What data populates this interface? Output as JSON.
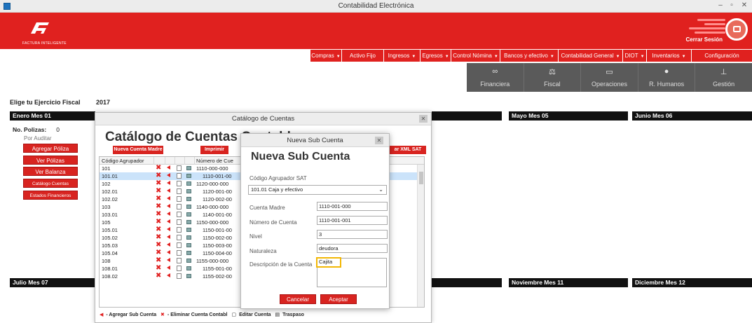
{
  "window": {
    "title": "Contabilidad Electrónica"
  },
  "brand": {
    "logo_text": "FACTURA INTELIGENTE",
    "logout": "Cerrar Sesión",
    "accent": "#e0211f"
  },
  "menu": [
    {
      "label": "Compras"
    },
    {
      "label": "Activo Fijo"
    },
    {
      "label": "Ingresos"
    },
    {
      "label": "Egresos"
    },
    {
      "label": "Control Nómina"
    },
    {
      "label": "Bancos y efectivo"
    },
    {
      "label": "Contabilidad General"
    },
    {
      "label": "DIOT"
    },
    {
      "label": "Inventarios"
    },
    {
      "label": "Configuración"
    }
  ],
  "modules": [
    {
      "label": "Financiera",
      "icon": "coins-icon"
    },
    {
      "label": "Fiscal",
      "icon": "scale-icon"
    },
    {
      "label": "Operaciones",
      "icon": "screen-icon"
    },
    {
      "label": "R. Humanos",
      "icon": "person-icon"
    },
    {
      "label": "Gestión",
      "icon": "org-chart-icon"
    }
  ],
  "fiscal": {
    "label": "Elige tu Ejercicio Fiscal",
    "year": "2017"
  },
  "months": {
    "m01": "Enero Mes 01",
    "m05": "Mayo Mes 05",
    "m06": "Junio Mes 06",
    "m07": "Julio Mes 07",
    "m11": "Noviembre Mes 11",
    "m12": "Diciembre Mes 12"
  },
  "left": {
    "polizas_label": "No. Polizas:",
    "polizas_count": "0",
    "por_auditar": "Por Auditar",
    "buttons": [
      "Agregar Póliza",
      "Ver Pólizas",
      "Ver Balanza",
      "Catálogo Cuentas",
      "Estados Financieros"
    ]
  },
  "catalog": {
    "window_title": "Catálogo de Cuentas",
    "heading": "Catálogo de Cuentas Contables",
    "btn_new_parent": "Nueva Cuenta Madre",
    "btn_print": "Imprimir",
    "btn_xml": "ar XML SAT",
    "col_code": "Código Agrupador",
    "col_number": "Número de Cue",
    "rows": [
      {
        "code": "101",
        "num": "1110-000-000"
      },
      {
        "code": "101.01",
        "num": "1110-001-00"
      },
      {
        "code": "102",
        "num": "1120-000-000"
      },
      {
        "code": "102.01",
        "num": "1120-001-00"
      },
      {
        "code": "102.02",
        "num": "1120-002-00"
      },
      {
        "code": "103",
        "num": "1140-000-000"
      },
      {
        "code": "103.01",
        "num": "1140-001-00"
      },
      {
        "code": "105",
        "num": "1150-000-000"
      },
      {
        "code": "105.01",
        "num": "1150-001-00"
      },
      {
        "code": "105.02",
        "num": "1150-002-00"
      },
      {
        "code": "105.03",
        "num": "1150-003-00"
      },
      {
        "code": "105.04",
        "num": "1150-004-00"
      },
      {
        "code": "108",
        "num": "1155-000-000"
      },
      {
        "code": "108.01",
        "num": "1155-001-00"
      },
      {
        "code": "108.02",
        "num": "1155-002-00"
      }
    ],
    "legend_add": "- Agregar Sub Cuenta",
    "legend_delete": "- Eliminar Cuenta Contabl",
    "legend_edit": "Editar Cuenta",
    "legend_transfer": "Traspaso"
  },
  "subaccount": {
    "window_title": "Nueva Sub Cuenta",
    "heading": "Nueva Sub Cuenta",
    "sat_label": "Código Agrupador SAT",
    "sat_value": "101.01 Caja y efectivo",
    "parent_label": "Cuenta Madre",
    "parent_value": "1110-001-000",
    "number_label": "Número de Cuenta",
    "number_value": "1110-001-001",
    "level_label": "Nivel",
    "level_value": "3",
    "nature_label": "Naturaleza",
    "nature_value": "deudora",
    "desc_label": "Descripción de la Cuenta",
    "desc_value": "Cajita",
    "cancel": "Cancelar",
    "accept": "Aceptar"
  }
}
